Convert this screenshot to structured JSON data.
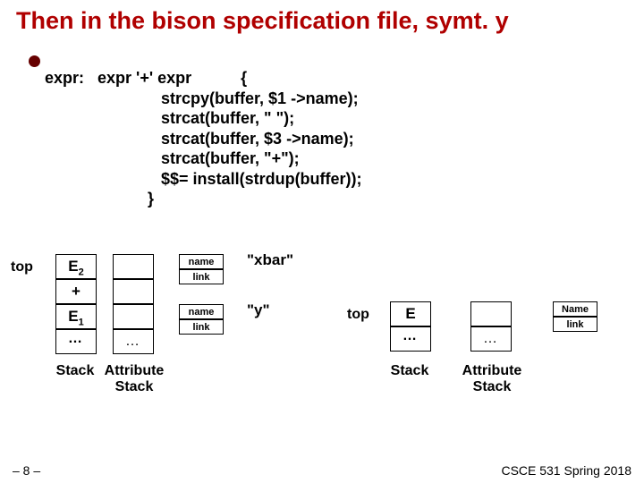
{
  "title": "Then in the bison specification file, symt. y",
  "code": {
    "l1": "expr:   expr '+' expr           {",
    "l2": "                          strcpy(buffer, $1 ->name);",
    "l3": "                          strcat(buffer, \" \");",
    "l4": "                          strcat(buffer, $3 ->name);",
    "l5": "                          strcat(buffer, \"+\");",
    "l6": "                          $$= install(strdup(buffer));",
    "l7": "                       }"
  },
  "left": {
    "top": "top",
    "stk": {
      "a": "E",
      "asub": "2",
      "b": "+",
      "c": "E",
      "csub": "1",
      "d": "…"
    },
    "attr": {
      "d": "…"
    },
    "rec1": {
      "name": "name",
      "link": "link",
      "val": "\"xbar\""
    },
    "rec2": {
      "name": "name",
      "link": "link",
      "val": "\"y\""
    },
    "lbl_stack": "Stack",
    "lbl_attr": "Attribute\nStack"
  },
  "right": {
    "top": "top",
    "stk": {
      "a": "E",
      "b": "…"
    },
    "attr": {
      "b": "…"
    },
    "rec": {
      "name": "Name",
      "link": "link"
    },
    "lbl_stack": "Stack",
    "lbl_attr": "Attribute\nStack"
  },
  "footer": {
    "left": "– 8 –",
    "right": "CSCE 531 Spring 2018"
  }
}
